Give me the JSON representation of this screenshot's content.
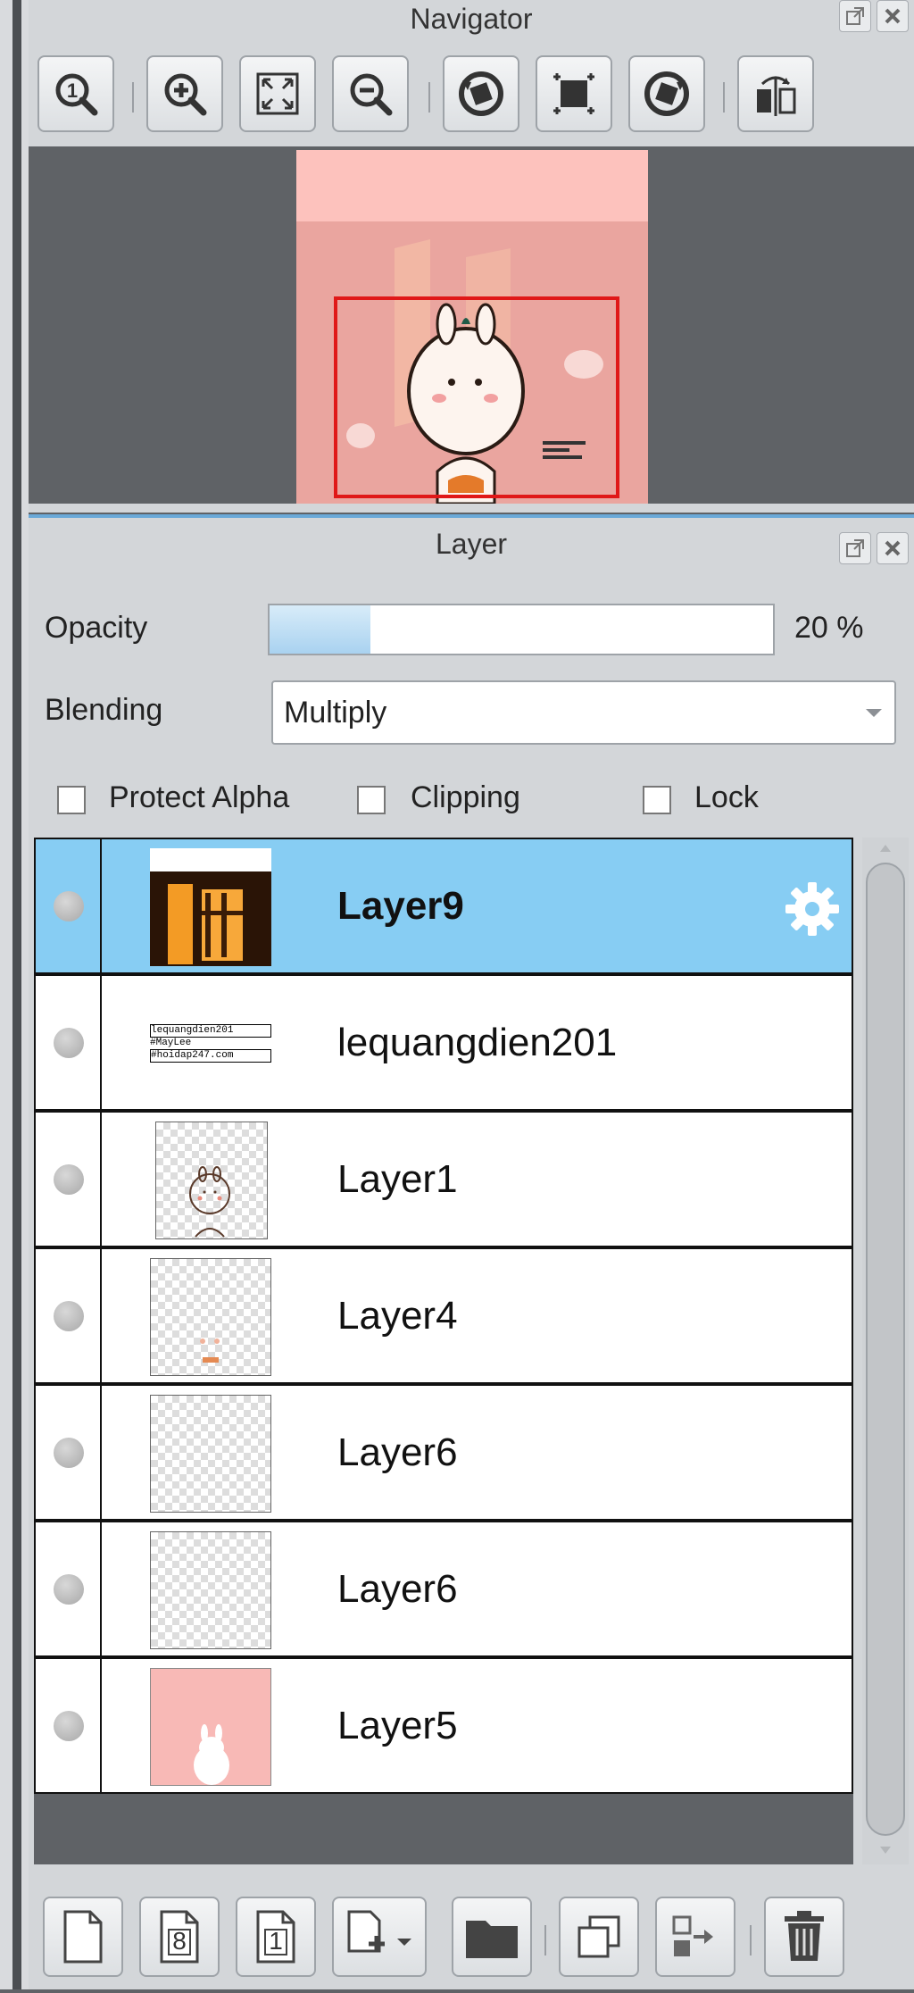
{
  "navigator": {
    "title": "Navigator",
    "toolbar": [
      {
        "icon": "zoom-100-icon"
      },
      {
        "icon": "zoom-in-icon"
      },
      {
        "icon": "fit-window-icon"
      },
      {
        "icon": "zoom-out-icon"
      },
      {
        "icon": "rotate-left-icon"
      },
      {
        "icon": "reset-view-icon"
      },
      {
        "icon": "rotate-right-icon"
      },
      {
        "icon": "flip-horizontal-icon"
      }
    ]
  },
  "layer_panel": {
    "title": "Layer",
    "opacity_label": "Opacity",
    "opacity_value": 20,
    "opacity_text": "20 %",
    "blending_label": "Blending",
    "blending_value": "Multiply",
    "protect_alpha_label": "Protect Alpha",
    "clipping_label": "Clipping",
    "lock_label": "Lock",
    "layers": [
      {
        "name": "Layer9",
        "selected": true
      },
      {
        "name": "lequangdien201",
        "selected": false
      },
      {
        "name": "Layer1",
        "selected": false
      },
      {
        "name": "Layer4",
        "selected": false
      },
      {
        "name": "Layer6",
        "selected": false
      },
      {
        "name": "Layer6",
        "selected": false
      },
      {
        "name": "Layer5",
        "selected": false
      }
    ],
    "thumb_text": [
      "lequangdien201",
      "#MayLee",
      "#hoidap247.com"
    ],
    "bottom_toolbar": [
      {
        "icon": "new-layer-icon"
      },
      {
        "icon": "new-8bit-layer-icon",
        "label": "8"
      },
      {
        "icon": "new-1bit-layer-icon",
        "label": "1"
      },
      {
        "icon": "add-layer-dropdown-icon"
      },
      {
        "icon": "folder-icon"
      },
      {
        "icon": "duplicate-layer-icon"
      },
      {
        "icon": "merge-down-icon"
      },
      {
        "icon": "delete-layer-icon"
      }
    ]
  },
  "colors": {
    "selected_row": "#87cdf3",
    "accent_red": "#e01818",
    "canvas_pink": "#f3b3ad"
  }
}
